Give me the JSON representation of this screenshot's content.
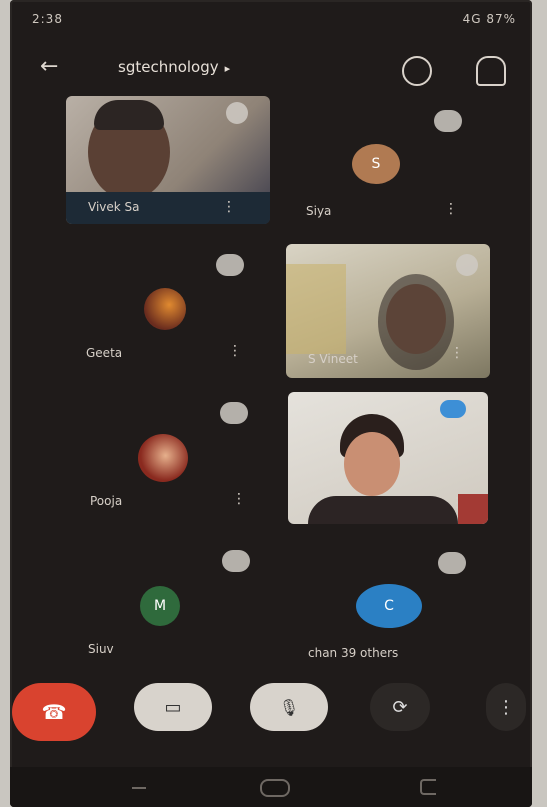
{
  "status_bar": {
    "time": "2:38",
    "right": "4G 87%"
  },
  "header": {
    "title": "sgtechnology",
    "caret": "▸"
  },
  "participants": [
    {
      "name": "Vivek Sa",
      "type": "video"
    },
    {
      "name": "Siya",
      "type": "initial",
      "initial": "S",
      "color": "#b07a52"
    },
    {
      "name": "Geeta",
      "type": "photo"
    },
    {
      "name": "S Vineet",
      "type": "video"
    },
    {
      "name": "Pooja",
      "type": "photo"
    },
    {
      "name": "",
      "type": "video"
    },
    {
      "name": "Siuv",
      "type": "initial",
      "initial": "M",
      "color": "#2f6a3c"
    },
    {
      "name": "chan 39 others",
      "type": "initial",
      "initial": "C",
      "color": "#2b80c4"
    }
  ],
  "icons": {
    "back": "←",
    "more": "⋮",
    "phone": "☎",
    "chat": "▭",
    "mic": "🎙",
    "camera": "⟳"
  }
}
